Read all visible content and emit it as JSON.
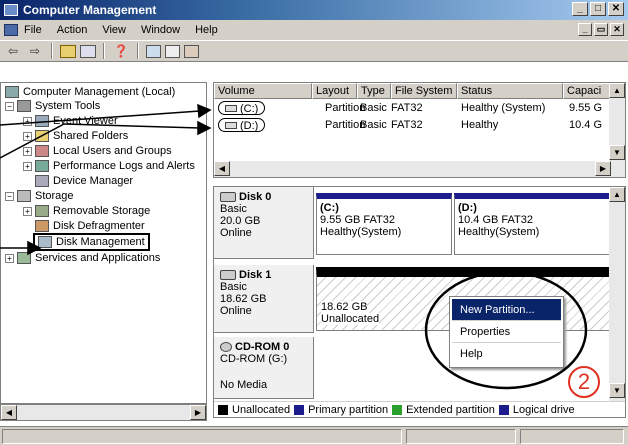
{
  "window": {
    "title": "Computer Management"
  },
  "menu": {
    "items": [
      "File",
      "Action",
      "View",
      "Window",
      "Help"
    ]
  },
  "tree": {
    "root": "Computer Management (Local)",
    "system_tools": "System Tools",
    "event_viewer": "Event Viewer",
    "shared_folders": "Shared Folders",
    "local_users": "Local Users and Groups",
    "perf_logs": "Performance Logs and Alerts",
    "device_manager": "Device Manager",
    "storage": "Storage",
    "removable_storage": "Removable Storage",
    "disk_defrag": "Disk Defragmenter",
    "disk_management": "Disk Management",
    "services_apps": "Services and Applications"
  },
  "volume_list": {
    "headers": [
      "Volume",
      "Layout",
      "Type",
      "File System",
      "Status",
      "Capaci"
    ],
    "rows": [
      {
        "volume": "(C:)",
        "layout": "Partition",
        "type": "Basic",
        "fs": "FAT32",
        "status": "Healthy (System)",
        "capacity": "9.55 G"
      },
      {
        "volume": "(D:)",
        "layout": "Partition",
        "type": "Basic",
        "fs": "FAT32",
        "status": "Healthy",
        "capacity": "10.4 G"
      }
    ]
  },
  "disks": {
    "disk0": {
      "name": "Disk 0",
      "type": "Basic",
      "size": "20.0  GB",
      "state": "Online",
      "c": {
        "label": "(C:)",
        "size": "9.55 GB FAT32",
        "status": "Healthy(System)"
      },
      "d": {
        "label": "(D:)",
        "size": "10.4 GB FAT32",
        "status": "Healthy(System)"
      }
    },
    "disk1": {
      "name": "Disk 1",
      "type": "Basic",
      "size": "18.62 GB",
      "state": "Online",
      "unalloc_size": "18.62 GB",
      "unalloc_label": "Unallocated"
    },
    "cdrom": {
      "name": "CD-ROM 0",
      "drive": "CD-ROM (G:)",
      "media": "No Media"
    }
  },
  "legend": [
    "Unallocated",
    "Primary partition",
    "Extended partition",
    "Logical drive"
  ],
  "context_menu": [
    "New Partition...",
    "Properties",
    "Help"
  ],
  "annotation_number": "2",
  "colors": {
    "primary": "#1c1c8c",
    "unallocated": "#000000",
    "extended": "#2ca02c",
    "logical": "#1c1c8c",
    "highlight": "#0a246a"
  }
}
